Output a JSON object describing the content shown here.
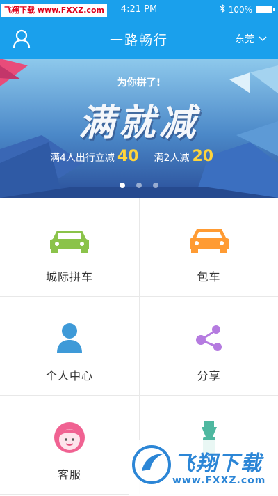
{
  "status_bar": {
    "watermark": "飞翔下载 www.FXXZ.com",
    "time": "4:21 PM",
    "battery": "100%",
    "battery_level": 1.0
  },
  "nav": {
    "title": "一路畅行",
    "city": "东莞"
  },
  "banner": {
    "subtitle": "为你拼了!",
    "headline": "满就减",
    "promo1_text": "满4人出行立减",
    "promo1_value": "40",
    "promo2_text": "满2人减",
    "promo2_value": "20",
    "slide_count": 3,
    "active_slide": 1
  },
  "menu": {
    "items": [
      {
        "label": "城际拼车",
        "icon": "car-green-icon"
      },
      {
        "label": "包车",
        "icon": "car-orange-icon"
      },
      {
        "label": "个人中心",
        "icon": "person-icon"
      },
      {
        "label": "分享",
        "icon": "share-icon"
      },
      {
        "label": "客服",
        "icon": "customer-service-icon"
      },
      {
        "label": "",
        "icon": "bottle-icon"
      }
    ]
  },
  "watermark": {
    "brand": "飞翔下载",
    "url": "www.FXXZ.com"
  },
  "colors": {
    "primary": "#1aa0ec",
    "green": "#8bc34a",
    "orange": "#ff9b33",
    "blue": "#3e9ad8",
    "purple": "#b57be0",
    "pink": "#f06292",
    "teal": "#4fb8a0"
  }
}
